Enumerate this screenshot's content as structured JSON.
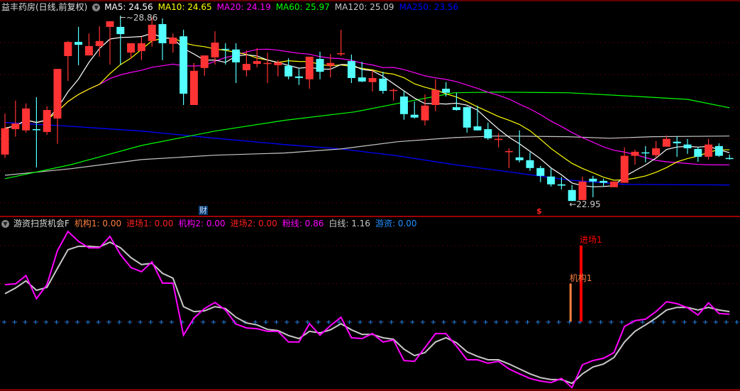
{
  "header": {
    "stock_name": "益丰药房(日线,前复权)",
    "ma_labels": [
      {
        "text": "MA5: 24.56",
        "color": "#ffffff"
      },
      {
        "text": "MA10: 24.65",
        "color": "#ffff00"
      },
      {
        "text": "MA20: 24.19",
        "color": "#ff00ff"
      },
      {
        "text": "MA60: 25.97",
        "color": "#00ff00"
      },
      {
        "text": "MA120: 25.09",
        "color": "#c8c8c8"
      },
      {
        "text": "MA250: 23.56",
        "color": "#0000ff"
      }
    ]
  },
  "annotations": {
    "high_label": "28.86",
    "low_label": "22.95",
    "cai_tag": "财",
    "s_tag": "$"
  },
  "indicator": {
    "name": "游资扫货机会F",
    "labels": [
      {
        "text": "机构1: 0.00",
        "color": "#ff8040"
      },
      {
        "text": "进场1: 0.00",
        "color": "#ff2020"
      },
      {
        "text": "机构2: 0.00",
        "color": "#ff00ff"
      },
      {
        "text": "进场2: 0.00",
        "color": "#ff2020"
      },
      {
        "text": "粉线: 0.86",
        "color": "#ff00ff"
      },
      {
        "text": "白线: 1.16",
        "color": "#c8c8c8"
      },
      {
        "text": "游资: 0.00",
        "color": "#1e90ff"
      }
    ],
    "signal_jigou1": {
      "label": "机构1",
      "index": 54,
      "value": 1.0,
      "color": "#ff8040"
    },
    "signal_jinchang1": {
      "label": "进场1",
      "index": 55,
      "value": 2.0,
      "color": "#ff0000"
    },
    "pink": [
      0.97,
      0.99,
      1.21,
      0.6,
      0.97,
      1.87,
      2.37,
      2.11,
      1.94,
      1.94,
      2.24,
      1.76,
      1.42,
      1.31,
      1.57,
      1.01,
      1.01,
      -0.36,
      0.09,
      0.34,
      0.5,
      0.3,
      -0.07,
      -0.17,
      -0.19,
      -0.26,
      -0.26,
      -0.54,
      -0.54,
      -0.06,
      -0.36,
      -0.11,
      0.11,
      -0.43,
      -0.45,
      -0.32,
      -0.54,
      -0.49,
      -1.03,
      -1.05,
      -0.69,
      -0.32,
      -0.32,
      -0.65,
      -1.01,
      -1.01,
      -1.1,
      -1.05,
      -1.25,
      -1.38,
      -1.5,
      -1.57,
      -1.61,
      -1.5,
      -1.74,
      -1.14,
      -1.03,
      -0.97,
      -0.82,
      -0.13,
      0.02,
      0.06,
      0.26,
      0.52,
      0.47,
      0.36,
      0.17,
      0.49,
      0.21,
      0.19
    ],
    "white": [
      0.73,
      0.88,
      1.07,
      0.82,
      0.9,
      1.4,
      1.89,
      1.98,
      1.98,
      1.96,
      2.09,
      1.94,
      1.68,
      1.5,
      1.53,
      1.27,
      1.14,
      0.39,
      0.26,
      0.28,
      0.39,
      0.34,
      0.11,
      -0.04,
      -0.09,
      -0.21,
      -0.24,
      -0.37,
      -0.45,
      -0.26,
      -0.3,
      -0.22,
      -0.06,
      -0.22,
      -0.34,
      -0.34,
      -0.43,
      -0.47,
      -0.73,
      -0.9,
      -0.82,
      -0.54,
      -0.43,
      -0.56,
      -0.8,
      -0.92,
      -1.01,
      -1.01,
      -1.12,
      -1.25,
      -1.38,
      -1.48,
      -1.53,
      -1.53,
      -1.63,
      -1.38,
      -1.2,
      -1.12,
      -0.95,
      -0.54,
      -0.26,
      -0.09,
      0.09,
      0.3,
      0.37,
      0.37,
      0.3,
      0.37,
      0.3,
      0.26
    ],
    "range": [
      -1.83,
      2.67
    ],
    "grid_levels": [
      0,
      1,
      2
    ]
  },
  "chart_data": {
    "type": "candlestick",
    "price_range": [
      22.6,
      29.36
    ],
    "grid_prices": [
      28.0,
      26.98,
      25.94,
      24.93,
      23.91,
      22.89
    ],
    "colors": {
      "up": "#ff3333",
      "down": "#54ffff"
    },
    "ohlc": [
      [
        24.43,
        25.74,
        24.32,
        25.27
      ],
      [
        25.24,
        26.15,
        25.0,
        25.42
      ],
      [
        25.2,
        26.06,
        25.13,
        25.9
      ],
      [
        25.24,
        26.26,
        24.02,
        25.22
      ],
      [
        25.15,
        25.97,
        25.06,
        25.85
      ],
      [
        25.58,
        27.16,
        24.77,
        27.16
      ],
      [
        27.57,
        28.05,
        26.78,
        28.02
      ],
      [
        28.02,
        28.5,
        27.28,
        27.93
      ],
      [
        27.59,
        28.29,
        27.59,
        27.89
      ],
      [
        27.89,
        28.52,
        27.55,
        28.05
      ],
      [
        28.5,
        28.68,
        27.3,
        28.68
      ],
      [
        28.5,
        28.86,
        27.3,
        28.27
      ],
      [
        27.68,
        27.98,
        27.48,
        27.98
      ],
      [
        27.73,
        28.18,
        27.44,
        27.98
      ],
      [
        28.05,
        28.81,
        27.87,
        28.57
      ],
      [
        28.59,
        28.77,
        27.44,
        27.98
      ],
      [
        27.96,
        28.29,
        27.68,
        28.16
      ],
      [
        28.2,
        28.41,
        26.01,
        26.37
      ],
      [
        26.01,
        27.35,
        26.01,
        27.1
      ],
      [
        27.19,
        27.59,
        26.94,
        27.59
      ],
      [
        27.53,
        28.36,
        27.3,
        28.0
      ],
      [
        27.8,
        27.98,
        27.3,
        27.78
      ],
      [
        27.78,
        27.98,
        26.71,
        27.37
      ],
      [
        27.12,
        27.75,
        26.92,
        27.32
      ],
      [
        27.32,
        27.82,
        27.21,
        27.41
      ],
      [
        27.34,
        27.68,
        26.71,
        27.35
      ],
      [
        27.28,
        27.44,
        26.92,
        27.37
      ],
      [
        27.26,
        27.5,
        26.83,
        26.92
      ],
      [
        26.92,
        27.16,
        26.65,
        26.87
      ],
      [
        26.83,
        27.55,
        26.53,
        27.55
      ],
      [
        27.48,
        27.71,
        26.83,
        27.07
      ],
      [
        27.26,
        27.64,
        26.89,
        27.35
      ],
      [
        27.65,
        28.41,
        27.57,
        27.66
      ],
      [
        27.41,
        27.62,
        26.71,
        26.87
      ],
      [
        26.89,
        27.39,
        26.74,
        26.76
      ],
      [
        26.74,
        27.12,
        26.44,
        26.87
      ],
      [
        26.85,
        27.07,
        26.37,
        26.46
      ],
      [
        26.48,
        26.53,
        26.15,
        26.49
      ],
      [
        26.28,
        26.46,
        25.54,
        25.72
      ],
      [
        25.7,
        26.12,
        25.58,
        25.61
      ],
      [
        25.52,
        26.35,
        25.36,
        25.99
      ],
      [
        26.01,
        26.83,
        25.81,
        26.49
      ],
      [
        26.53,
        26.74,
        26.28,
        26.4
      ],
      [
        25.94,
        26.4,
        25.83,
        25.85
      ],
      [
        25.94,
        25.97,
        25.13,
        25.29
      ],
      [
        25.33,
        25.99,
        25.2,
        25.2
      ],
      [
        25.24,
        25.45,
        24.9,
        24.95
      ],
      [
        24.92,
        25.11,
        24.66,
        24.93
      ],
      [
        24.53,
        24.63,
        24.0,
        24.54
      ],
      [
        24.34,
        25.2,
        24.18,
        24.25
      ],
      [
        24.25,
        24.5,
        23.91,
        24.0
      ],
      [
        24.0,
        24.07,
        23.55,
        23.75
      ],
      [
        23.73,
        23.98,
        23.41,
        23.48
      ],
      [
        23.48,
        23.71,
        23.32,
        23.44
      ],
      [
        23.3,
        23.46,
        22.95,
        22.95
      ],
      [
        22.98,
        23.73,
        22.98,
        23.57
      ],
      [
        23.66,
        23.75,
        23.07,
        23.57
      ],
      [
        23.59,
        23.66,
        23.41,
        23.53
      ],
      [
        23.39,
        23.57,
        23.39,
        23.57
      ],
      [
        23.53,
        24.66,
        23.53,
        24.39
      ],
      [
        24.39,
        24.59,
        24.11,
        24.52
      ],
      [
        24.5,
        24.7,
        24.18,
        24.48
      ],
      [
        24.41,
        24.86,
        24.32,
        24.63
      ],
      [
        24.68,
        25.04,
        24.68,
        24.93
      ],
      [
        24.84,
        25.02,
        24.36,
        24.79
      ],
      [
        24.75,
        24.93,
        24.45,
        24.63
      ],
      [
        24.61,
        24.66,
        24.2,
        24.36
      ],
      [
        24.36,
        24.93,
        24.27,
        24.75
      ],
      [
        24.7,
        24.79,
        24.36,
        24.39
      ],
      [
        24.32,
        24.43,
        24.27,
        24.31
      ]
    ],
    "ma60": [
      [
        0,
        23.66
      ],
      [
        6.3,
        24.11
      ],
      [
        13,
        24.72
      ],
      [
        20,
        25.18
      ],
      [
        26.6,
        25.52
      ],
      [
        33.3,
        25.79
      ],
      [
        37.4,
        26.06
      ],
      [
        42.8,
        26.4
      ],
      [
        46.8,
        26.42
      ],
      [
        53.6,
        26.4
      ],
      [
        60.3,
        26.28
      ],
      [
        65,
        26.19
      ],
      [
        69,
        25.92
      ]
    ],
    "ma120": [
      [
        0,
        23.77
      ],
      [
        6.3,
        23.98
      ],
      [
        13,
        24.27
      ],
      [
        20,
        24.41
      ],
      [
        26.6,
        24.48
      ],
      [
        32,
        24.61
      ],
      [
        37.4,
        24.84
      ],
      [
        42.8,
        24.97
      ],
      [
        46.8,
        25.02
      ],
      [
        53.6,
        25.0
      ],
      [
        57.6,
        24.95
      ],
      [
        61.7,
        25.0
      ],
      [
        69,
        25.02
      ]
    ],
    "ma250": [
      [
        0,
        25.45
      ],
      [
        6.3,
        25.33
      ],
      [
        13,
        25.18
      ],
      [
        20,
        24.95
      ],
      [
        26.6,
        24.75
      ],
      [
        32,
        24.61
      ],
      [
        37.4,
        24.39
      ],
      [
        42.8,
        24.11
      ],
      [
        48.2,
        23.87
      ],
      [
        53.6,
        23.62
      ],
      [
        59,
        23.48
      ],
      [
        69,
        23.46
      ]
    ],
    "high_index": 11,
    "low_index": 54
  }
}
